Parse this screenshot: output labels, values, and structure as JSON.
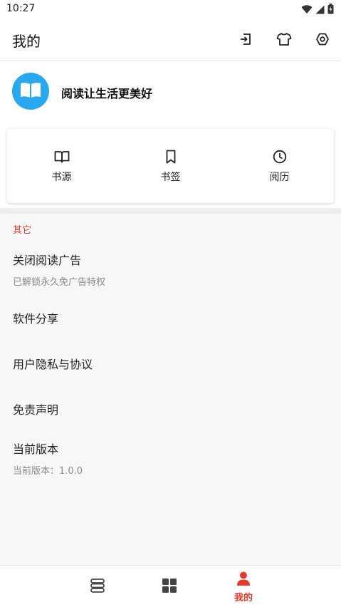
{
  "status": {
    "time": "10:27"
  },
  "header": {
    "title": "我的",
    "icons": [
      "import-icon",
      "theme-shirt-icon",
      "settings-icon"
    ]
  },
  "profile": {
    "slogan": "阅读让生活更美好",
    "logo_color": "#2aa8ef"
  },
  "quick_actions": [
    {
      "label": "书源",
      "icon": "book-open-icon"
    },
    {
      "label": "书签",
      "icon": "bookmark-icon"
    },
    {
      "label": "阅历",
      "icon": "clock-icon"
    }
  ],
  "other_section": {
    "header": "其它",
    "items": [
      {
        "title": "关闭阅读广告",
        "subtitle": "已解锁永久免广告特权"
      },
      {
        "title": "软件分享"
      },
      {
        "title": "用户隐私与协议"
      },
      {
        "title": "免责声明"
      },
      {
        "title": "当前版本",
        "subtitle": "当前版本：1.0.0"
      }
    ]
  },
  "bottom_nav": {
    "items": [
      {
        "icon": "bookshelf-icon"
      },
      {
        "icon": "discover-grid-icon"
      },
      {
        "label": "我的",
        "icon": "person-icon",
        "active": true
      }
    ]
  },
  "colors": {
    "accent": "#e23b2e",
    "section_header": "#d43c33"
  }
}
